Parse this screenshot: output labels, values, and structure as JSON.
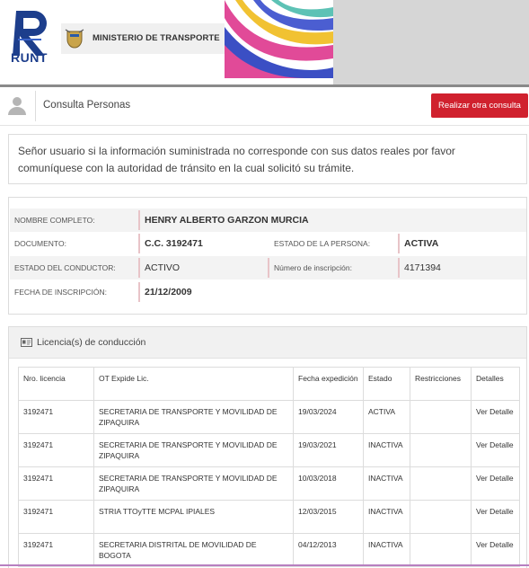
{
  "header": {
    "runt_label": "RUNT",
    "ministry_label": "MINISTERIO DE TRANSPORTE"
  },
  "titlebar": {
    "title": "Consulta Personas",
    "new_query_button": "Realizar otra consulta"
  },
  "notice": {
    "text": "Señor usuario si la información suministrada no corresponde con sus datos reales por favor comuníquese con la autoridad de tránsito en la cual solicitó su trámite."
  },
  "person": {
    "full_name_label": "NOMBRE COMPLETO:",
    "full_name": "HENRY ALBERTO GARZON MURCIA",
    "document_label": "DOCUMENTO:",
    "document": "C.C. 3192471",
    "person_status_label": "ESTADO DE LA PERSONA:",
    "person_status": "ACTIVA",
    "driver_status_label": "ESTADO DEL CONDUCTOR:",
    "driver_status": "ACTIVO",
    "registration_number_label": "Número de inscripción:",
    "registration_number": "4171394",
    "registration_date_label": "FECHA DE INSCRIPCIÓN:",
    "registration_date": "21/12/2009"
  },
  "licenses": {
    "title": "Licencia(s) de conducción",
    "columns": [
      "Nro. licencia",
      "OT Expide Lic.",
      "Fecha expedición",
      "Estado",
      "Restricciones",
      "Detalles"
    ],
    "rows": [
      {
        "number": "3192471",
        "issuer": "SECRETARIA DE TRANSPORTE Y MOVILIDAD DE ZIPAQUIRA",
        "date": "19/03/2024",
        "status": "ACTIVA",
        "restrictions": "",
        "details": "Ver Detalle"
      },
      {
        "number": "3192471",
        "issuer": "SECRETARIA DE TRANSPORTE Y MOVILIDAD DE ZIPAQUIRA",
        "date": "19/03/2021",
        "status": "INACTIVA",
        "restrictions": "",
        "details": "Ver Detalle"
      },
      {
        "number": "3192471",
        "issuer": "SECRETARIA DE TRANSPORTE Y MOVILIDAD DE ZIPAQUIRA",
        "date": "10/03/2018",
        "status": "INACTIVA",
        "restrictions": "",
        "details": "Ver Detalle"
      },
      {
        "number": "3192471",
        "issuer": "STRIA TTOyTTE MCPAL IPIALES",
        "date": "12/03/2015",
        "status": "INACTIVA",
        "restrictions": "",
        "details": "Ver Detalle"
      },
      {
        "number": "3192471",
        "issuer": "SECRETARIA DISTRITAL DE MOVILIDAD DE BOGOTA",
        "date": "04/12/2013",
        "status": "INACTIVA",
        "restrictions": "",
        "details": "Ver Detalle"
      }
    ]
  }
}
